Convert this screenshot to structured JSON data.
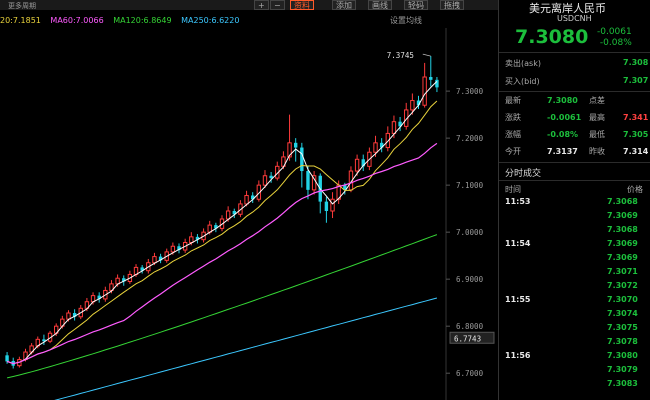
{
  "toolbar": {
    "more_cycles": "更多周期",
    "plus": "+",
    "minus": "−",
    "indicator_label": "资料",
    "add_label": "添加",
    "view_label": "画线",
    "feature_label": "轻码",
    "extra_label": "拖拽",
    "settings_label": "设置均线"
  },
  "ma_legend": [
    {
      "label": "20:7.1851",
      "color": "#e8d23c"
    },
    {
      "label": "MA60:7.0066",
      "color": "#ff5cff"
    },
    {
      "label": "MA120:6.8649",
      "color": "#35d435"
    },
    {
      "label": "MA250:6.6220",
      "color": "#3cc8ff"
    }
  ],
  "chart": {
    "peak_label": "7.3745",
    "current_price_label": "6.7743",
    "y_ticks": [
      "7.3000",
      "7.2000",
      "7.1000",
      "7.0000",
      "6.9000",
      "6.8000",
      "6.7000"
    ]
  },
  "chart_data": {
    "type": "candlestick",
    "ylim": [
      6.66,
      7.43
    ],
    "y_ticks": [
      7.3,
      7.2,
      7.1,
      7.0,
      6.9,
      6.8,
      6.7
    ],
    "annotations": [
      "7.3745",
      "6.7743"
    ],
    "candles": [
      [
        6.738,
        6.725,
        6.745,
        6.72
      ],
      [
        6.726,
        6.716,
        6.733,
        6.71
      ],
      [
        6.716,
        6.729,
        6.735,
        6.712
      ],
      [
        6.729,
        6.745,
        6.752,
        6.725
      ],
      [
        6.745,
        6.758,
        6.764,
        6.74
      ],
      [
        6.758,
        6.772,
        6.778,
        6.753
      ],
      [
        6.772,
        6.768,
        6.782,
        6.76
      ],
      [
        6.768,
        6.785,
        6.79,
        6.764
      ],
      [
        6.785,
        6.8,
        6.806,
        6.779
      ],
      [
        6.8,
        6.815,
        6.822,
        6.795
      ],
      [
        6.815,
        6.828,
        6.834,
        6.81
      ],
      [
        6.828,
        6.82,
        6.836,
        6.812
      ],
      [
        6.82,
        6.838,
        6.845,
        6.815
      ],
      [
        6.838,
        6.852,
        6.86,
        6.832
      ],
      [
        6.852,
        6.865,
        6.872,
        6.846
      ],
      [
        6.865,
        6.858,
        6.872,
        6.85
      ],
      [
        6.858,
        6.876,
        6.884,
        6.852
      ],
      [
        6.876,
        6.89,
        6.898,
        6.87
      ],
      [
        6.89,
        6.902,
        6.91,
        6.884
      ],
      [
        6.902,
        6.895,
        6.908,
        6.886
      ],
      [
        6.895,
        6.91,
        6.918,
        6.89
      ],
      [
        6.91,
        6.925,
        6.932,
        6.905
      ],
      [
        6.925,
        6.918,
        6.93,
        6.912
      ],
      [
        6.918,
        6.935,
        6.943,
        6.912
      ],
      [
        6.935,
        6.948,
        6.956,
        6.93
      ],
      [
        6.948,
        6.94,
        6.954,
        6.934
      ],
      [
        6.94,
        6.958,
        6.965,
        6.935
      ],
      [
        6.958,
        6.97,
        6.978,
        6.952
      ],
      [
        6.97,
        6.962,
        6.976,
        6.955
      ],
      [
        6.962,
        6.978,
        6.986,
        6.956
      ],
      [
        6.978,
        6.99,
        7.0,
        6.972
      ],
      [
        6.99,
        6.984,
        6.996,
        6.976
      ],
      [
        6.984,
        7.0,
        7.008,
        6.978
      ],
      [
        7.0,
        7.015,
        7.024,
        6.995
      ],
      [
        7.015,
        7.008,
        7.02,
        7.0
      ],
      [
        7.008,
        7.028,
        7.036,
        7.002
      ],
      [
        7.028,
        7.045,
        7.055,
        7.022
      ],
      [
        7.045,
        7.038,
        7.05,
        7.03
      ],
      [
        7.038,
        7.06,
        7.068,
        7.032
      ],
      [
        7.06,
        7.078,
        7.088,
        7.055
      ],
      [
        7.078,
        7.07,
        7.085,
        7.062
      ],
      [
        7.07,
        7.1,
        7.11,
        7.065
      ],
      [
        7.1,
        7.12,
        7.132,
        7.094
      ],
      [
        7.12,
        7.115,
        7.128,
        7.105
      ],
      [
        7.115,
        7.14,
        7.15,
        7.11
      ],
      [
        7.14,
        7.16,
        7.172,
        7.134
      ],
      [
        7.16,
        7.19,
        7.25,
        7.152
      ],
      [
        7.19,
        7.18,
        7.2,
        7.15
      ],
      [
        7.18,
        7.13,
        7.19,
        7.095
      ],
      [
        7.13,
        7.09,
        7.14,
        7.07
      ],
      [
        7.09,
        7.12,
        7.13,
        7.08
      ],
      [
        7.12,
        7.065,
        7.125,
        7.04
      ],
      [
        7.065,
        7.045,
        7.075,
        7.02
      ],
      [
        7.045,
        7.07,
        7.085,
        7.03
      ],
      [
        7.07,
        7.1,
        7.11,
        7.06
      ],
      [
        7.1,
        7.09,
        7.105,
        7.08
      ],
      [
        7.09,
        7.13,
        7.14,
        7.085
      ],
      [
        7.13,
        7.155,
        7.165,
        7.12
      ],
      [
        7.155,
        7.14,
        7.165,
        7.13
      ],
      [
        7.14,
        7.17,
        7.18,
        7.132
      ],
      [
        7.17,
        7.19,
        7.205,
        7.16
      ],
      [
        7.19,
        7.18,
        7.2,
        7.17
      ],
      [
        7.18,
        7.21,
        7.225,
        7.172
      ],
      [
        7.21,
        7.235,
        7.248,
        7.2
      ],
      [
        7.235,
        7.225,
        7.245,
        7.215
      ],
      [
        7.225,
        7.26,
        7.275,
        7.218
      ],
      [
        7.26,
        7.28,
        7.295,
        7.25
      ],
      [
        7.28,
        7.27,
        7.29,
        7.262
      ],
      [
        7.27,
        7.33,
        7.36,
        7.265
      ],
      [
        7.33,
        7.324,
        7.3745,
        7.31
      ],
      [
        7.324,
        7.308,
        7.33,
        7.298
      ]
    ],
    "ma_lines": {
      "MA20": {
        "color": "#e8d23c",
        "last": 7.1851
      },
      "MA60": {
        "color": "#ff5cff",
        "last": 7.0066
      },
      "MA120": {
        "color": "#35d435",
        "last": 6.8649
      },
      "MA250": {
        "color": "#3cc8ff",
        "last": 6.622
      }
    }
  },
  "panel": {
    "title": "美元离岸人民币",
    "code": "USDCNH",
    "price": "7.3080",
    "change": "-0.0061",
    "change_pct": "-0.08%",
    "ask_label": "卖出(ask)",
    "ask_value": "7.308",
    "bid_label": "买入(bid)",
    "bid_value": "7.307",
    "quotes": [
      {
        "l1": "最新",
        "v1": "7.3080",
        "c1": "green",
        "l2": "点差",
        "v2": "",
        "c2": "white"
      },
      {
        "l1": "涨跌",
        "v1": "-0.0061",
        "c1": "green",
        "l2": "最高",
        "v2": "7.341",
        "c2": "red"
      },
      {
        "l1": "涨幅",
        "v1": "-0.08%",
        "c1": "green",
        "l2": "最低",
        "v2": "7.305",
        "c2": "green"
      },
      {
        "l1": "今开",
        "v1": "7.3137",
        "c1": "white",
        "l2": "昨收",
        "v2": "7.314",
        "c2": "white"
      }
    ],
    "trades_title": "分时成交",
    "col_time": "时间",
    "col_price": "价格",
    "trades": [
      {
        "t": "11:53",
        "p": "7.3068"
      },
      {
        "t": "",
        "p": "7.3069"
      },
      {
        "t": "",
        "p": "7.3068"
      },
      {
        "t": "11:54",
        "p": "7.3069"
      },
      {
        "t": "",
        "p": "7.3069"
      },
      {
        "t": "",
        "p": "7.3071"
      },
      {
        "t": "",
        "p": "7.3072"
      },
      {
        "t": "11:55",
        "p": "7.3070"
      },
      {
        "t": "",
        "p": "7.3074"
      },
      {
        "t": "",
        "p": "7.3075"
      },
      {
        "t": "",
        "p": "7.3078"
      },
      {
        "t": "11:56",
        "p": "7.3080"
      },
      {
        "t": "",
        "p": "7.3079"
      },
      {
        "t": "",
        "p": "7.3083"
      }
    ]
  }
}
